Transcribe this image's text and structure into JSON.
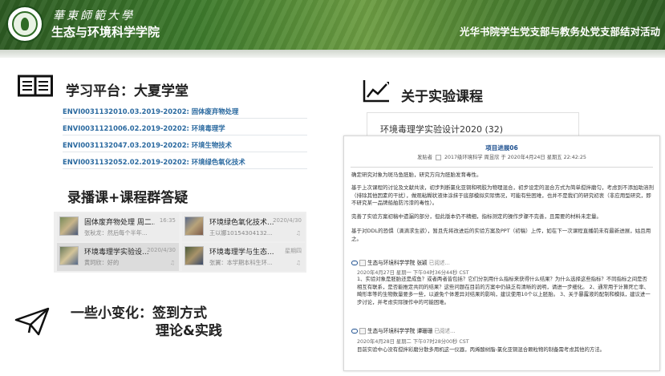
{
  "header": {
    "university": "華東師範大學",
    "college": "生态与环境科学学院",
    "activity_title": "光华书院学生党支部与教务处党支部结对活动"
  },
  "platform_section": {
    "title": "学习平台：大夏学堂",
    "icon": "book-icon",
    "courses": [
      "ENVI0031132010.03.2019-20202: 固体废弃物处理",
      "ENVI0031121006.02.2019-20202: 环境毒理学",
      "ENVI0031132047.03.2019-20202: 环境生物技术",
      "ENVI0031132052.02.2019-20202: 环境绿色氧化技术"
    ]
  },
  "replay_section": {
    "title": "录播课+课程群答疑",
    "chats": [
      {
        "name": "固体废弃物处理 周二...",
        "date": "16:35",
        "preview": "张秋龙：然后每个半年..."
      },
      {
        "name": "环境绿色氧化技术...",
        "date": "2020/4/30",
        "preview": "王以娜10154304132..."
      },
      {
        "name": "环境毒理学实验设...",
        "date": "2020/4/30",
        "preview": "黄珂欣：好的"
      },
      {
        "name": "环境毒理学与生态...",
        "date": "星期四",
        "preview": "张翼：本学期本科生环..."
      }
    ]
  },
  "change_section": {
    "title_line1": "一些小变化：签到方式",
    "title_line2": "理论&实践",
    "icon": "paper-plane-icon"
  },
  "course_section": {
    "title": "关于实验课程",
    "icon": "line-chart-icon",
    "course_card": "环境毒理学实验设计2020 (32)"
  },
  "doc": {
    "title": "项目进展06",
    "meta_prefix": "发贴者",
    "meta_author": "2017级环境科学 周昱欣",
    "meta_suffix": "于 2020年4月24日 星期五 22:42:25",
    "p1": "确定研究对象为斑马鱼胚胎，研究方向为胚胎发育毒性。",
    "p2": "基于上次课程的讨论及文献共读，初步判断氯化亚铜和明胶为物理混合，初步设定的混合方式为简单搅拌磨匀，考虑到不添加助溶剂（排除其他因素的干扰），做观粘糊状液体涂抹于底部模拟实际情况，可能有些困难，也并不是我们的研究初衷（非应用型研究，即不研究某一品牌船舶防污漆的毒性）。",
    "p3": "完善了实验方案初稿中遗漏的部分，但此版本仍不精细，指标测定的操作步骤不完善，且需要的材料未定量。",
    "p4": "基于对DDL的恐惧（滴滴求生欲），暂且先将改进后的实验方案及PPT（初稿）上传，如在下一次课程直播前未有最新进展，姑且用之。",
    "comment1": {
      "author": "生态与环境科学学院 张颖",
      "status": "已阅述...",
      "time": "2020年4月27日 星期一 下午04时36分44秒 CST",
      "body": "1、实验对象是胚胎还是成鱼？或者两者皆包括？它们分别用什么指标来获得什么结果？为什么选择这些指标？不同指标之间是否相互有联系，是否能推定共同的结果？这些问题在目前的方案中仍缺乏有清晰的说明，请进一步细化。 2、通常用于计算死亡率、畸形率等的生物数量要多一些，以避免个体差异对结果的影响，建议使用10个以上胚胎。 3、关于暴露液的配制和模拟，建议进一步讨论，并考虑实际操作中的可能困难。"
    },
    "comment2": {
      "author": "生态与环境科学学院 谭珊珊",
      "status": "已阅述...",
      "time": "2020年4月28日 星期二 下午07时28分00秒 CST",
      "body": "目前实验中心没有搅拌彩磨分散多用机这一仪器，丙烯酸树脂-氯化亚铜混合颗粒物的制备需考虑其他的方法。"
    }
  }
}
